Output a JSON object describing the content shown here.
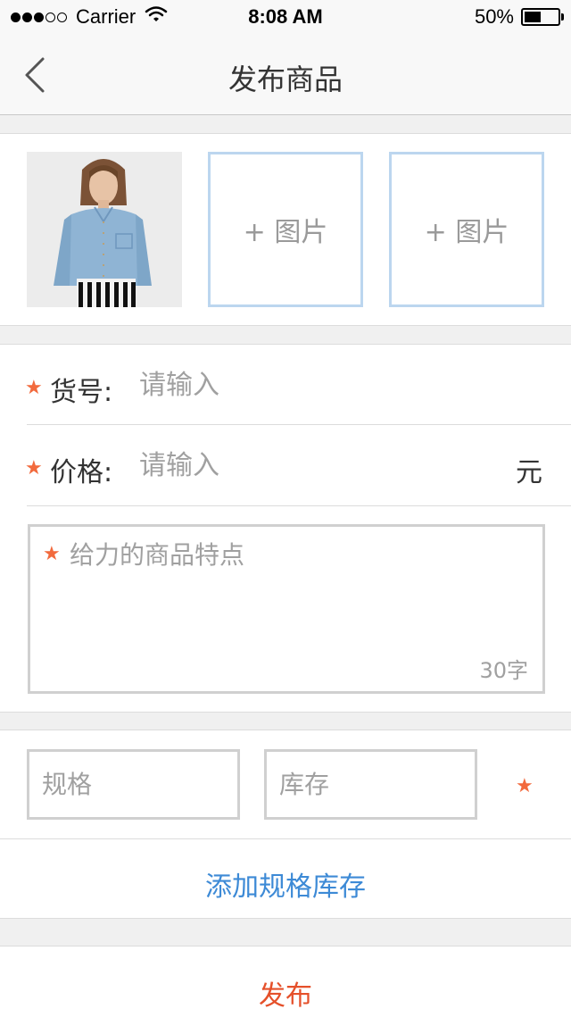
{
  "status_bar": {
    "carrier": "Carrier",
    "time": "8:08 AM",
    "battery_text": "50%",
    "battery_level": 0.5,
    "signal_bars_filled": 3,
    "signal_bars_total": 5
  },
  "nav": {
    "back_icon": "chevron-left-icon",
    "title": "发布商品"
  },
  "photos": {
    "main_photo": "product-photo-denim-shirt",
    "add_label": "+ 图片"
  },
  "form": {
    "required_mark": "★",
    "item_number": {
      "label": "货号:",
      "placeholder": "请输入",
      "value": ""
    },
    "price": {
      "label": "价格:",
      "placeholder": "请输入",
      "value": "",
      "unit": "元"
    },
    "description": {
      "placeholder": "给力的商品特点",
      "value": "",
      "counter": "30字"
    }
  },
  "spec": {
    "size_placeholder": "规格",
    "stock_placeholder": "库存",
    "add_label": "添加规格库存"
  },
  "publish": {
    "label": "发布"
  },
  "colors": {
    "accent_blue": "#3d8ad6",
    "required_star": "#f26a3d",
    "publish_red": "#e5502a",
    "slot_border": "#bcd6ef"
  }
}
